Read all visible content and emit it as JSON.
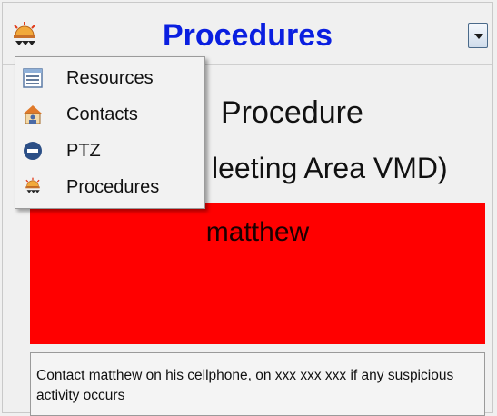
{
  "header": {
    "title": "Procedures",
    "app_icon": "siren-icon",
    "dropdown_icon": "chevron-down-icon"
  },
  "menu": {
    "items": [
      {
        "label": "Resources",
        "icon": "list-icon"
      },
      {
        "label": "Contacts",
        "icon": "contacts-icon"
      },
      {
        "label": "PTZ",
        "icon": "ptz-icon"
      },
      {
        "label": "Procedures",
        "icon": "siren-icon"
      }
    ]
  },
  "procedure": {
    "name_visible": "Procedure",
    "subtitle_visible": "leeting Area VMD)"
  },
  "alert": {
    "text": "matthew",
    "color": "#ff0000"
  },
  "notes": {
    "text": "Contact matthew on his cellphone, on xxx xxx xxx if any suspicious activity occurs"
  },
  "colors": {
    "title": "#0a1fe0",
    "alert_bg": "#ff0000"
  }
}
